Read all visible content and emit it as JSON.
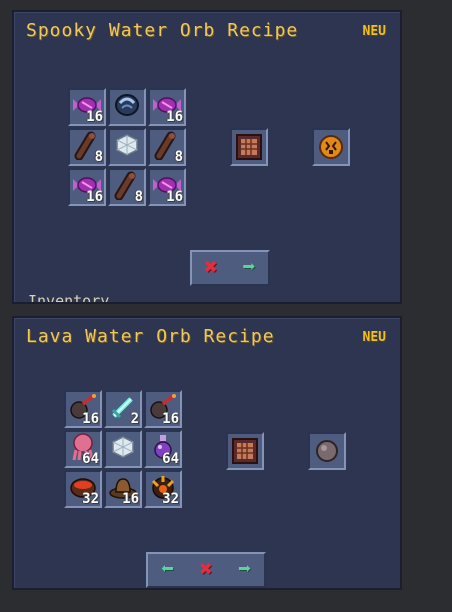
{
  "panels": [
    {
      "title": "Spooky Water Orb Recipe",
      "badge": "NEU",
      "grid": [
        {
          "icon": "purple-candy-icon",
          "count": "16"
        },
        {
          "icon": "water-orb-icon",
          "count": ""
        },
        {
          "icon": "purple-candy-icon",
          "count": "16"
        },
        {
          "icon": "dark-bone-icon",
          "count": "8"
        },
        {
          "icon": "diamond-block-icon",
          "count": ""
        },
        {
          "icon": "dark-bone-icon",
          "count": "8"
        },
        {
          "icon": "purple-candy-icon",
          "count": "16"
        },
        {
          "icon": "dark-bone-icon",
          "count": "8"
        },
        {
          "icon": "purple-candy-icon",
          "count": "16"
        }
      ],
      "station_icon": "crafting-table-icon",
      "result_icon": "spooky-orb-icon",
      "buttons": {
        "close": "✖",
        "next": "➡"
      },
      "footer_label": "Inventory"
    },
    {
      "title": "Lava Water Orb Recipe",
      "badge": "NEU",
      "grid": [
        {
          "icon": "bomb-icon",
          "count": "16"
        },
        {
          "icon": "ice-sword-icon",
          "count": "2"
        },
        {
          "icon": "bomb-icon",
          "count": "16"
        },
        {
          "icon": "pink-squid-icon",
          "count": "64"
        },
        {
          "icon": "diamond-block-icon",
          "count": ""
        },
        {
          "icon": "purple-potion-icon",
          "count": "64"
        },
        {
          "icon": "lava-bucket-icon",
          "count": "32"
        },
        {
          "icon": "brown-hat-icon",
          "count": "16"
        },
        {
          "icon": "fire-orb-icon",
          "count": "32"
        }
      ],
      "station_icon": "crafting-table-icon",
      "result_icon": "gray-orb-icon",
      "buttons": {
        "prev": "⬅",
        "close": "✖",
        "next": "➡"
      }
    }
  ]
}
